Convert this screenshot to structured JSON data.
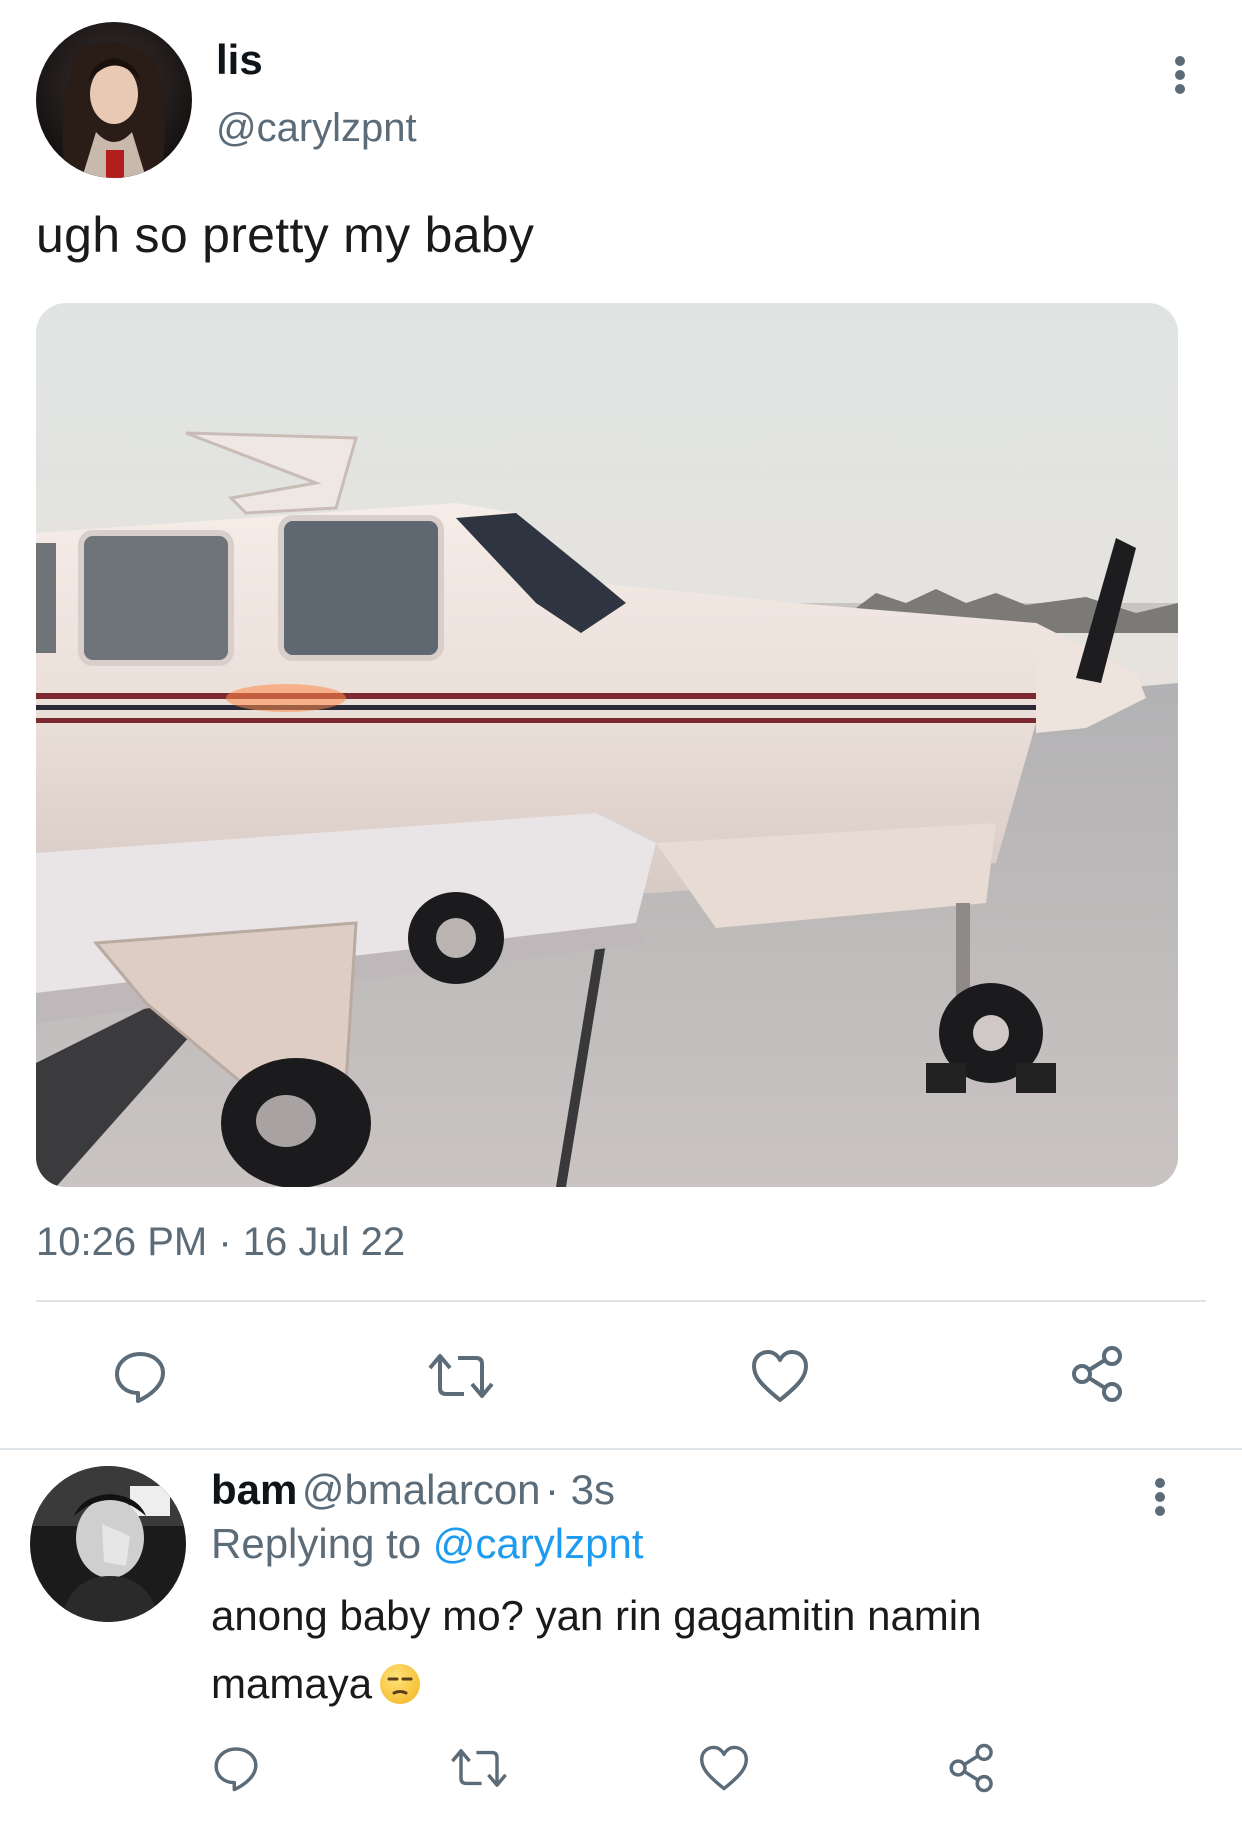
{
  "tweet": {
    "author_name": "lis",
    "author_handle": "@carylzpnt",
    "text": "ugh so pretty my baby",
    "timestamp": "10:26 PM · 16 Jul 22",
    "image_description_icon": "airplane-photo",
    "actions": [
      "reply-icon",
      "retweet-icon",
      "like-icon",
      "share-icon"
    ]
  },
  "reply": {
    "author_name": "bam",
    "author_handle": "@bmalarcon",
    "time": "· 3s",
    "replying_to_label": "Replying to",
    "replying_to_handle": "@carylzpnt",
    "text_line1": "anong baby mo? yan rin gagamitin namin",
    "text_line2": "mamaya",
    "emoji": "unamused-face",
    "actions": [
      "reply-icon",
      "retweet-icon",
      "like-icon",
      "share-icon"
    ]
  },
  "colors": {
    "link": "#1d9bf0",
    "secondary_text": "#5b6b78",
    "divider": "#dfe4e8"
  }
}
